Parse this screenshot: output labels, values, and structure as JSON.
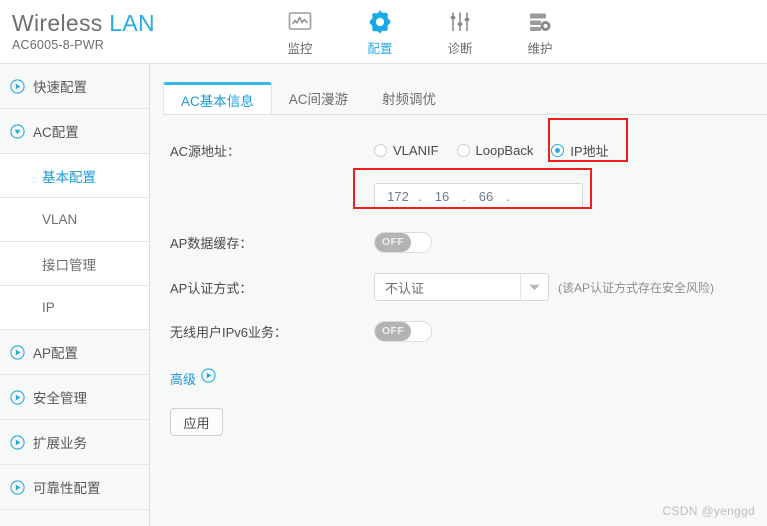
{
  "header": {
    "brand_main": "Wireless",
    "brand_accent": "LAN",
    "model": "AC6005-8-PWR",
    "nav": [
      {
        "label": "监控",
        "icon": "monitor-chart-icon",
        "active": false
      },
      {
        "label": "配置",
        "icon": "gear-icon",
        "active": true
      },
      {
        "label": "诊断",
        "icon": "sliders-icon",
        "active": false
      },
      {
        "label": "维护",
        "icon": "server-gear-icon",
        "active": false
      }
    ]
  },
  "sidebar": {
    "items": [
      {
        "label": "快速配置",
        "icon": "circle-play-icon",
        "type": "group",
        "expanded": false
      },
      {
        "label": "AC配置",
        "icon": "circle-chevron-down-icon",
        "type": "group",
        "expanded": true
      },
      {
        "label": "基本配置",
        "type": "sub",
        "active": true
      },
      {
        "label": "VLAN",
        "type": "sub",
        "active": false
      },
      {
        "label": "接口管理",
        "type": "sub",
        "active": false
      },
      {
        "label": "IP",
        "type": "sub",
        "active": false
      },
      {
        "label": "AP配置",
        "icon": "circle-play-icon",
        "type": "group",
        "expanded": false
      },
      {
        "label": "安全管理",
        "icon": "circle-play-icon",
        "type": "group",
        "expanded": false
      },
      {
        "label": "扩展业务",
        "icon": "circle-play-icon",
        "type": "group",
        "expanded": false
      },
      {
        "label": "可靠性配置",
        "icon": "circle-play-icon",
        "type": "group",
        "expanded": false
      }
    ]
  },
  "main": {
    "tabs": [
      {
        "label": "AC基本信息",
        "active": true
      },
      {
        "label": "AC间漫游",
        "active": false
      },
      {
        "label": "射频调优",
        "active": false
      }
    ],
    "rows": {
      "source_address": {
        "label": "AC源地址：",
        "options": [
          {
            "label": "VLANIF",
            "checked": false
          },
          {
            "label": "LoopBack",
            "checked": false
          },
          {
            "label": "IP地址",
            "checked": true
          }
        ],
        "ip": {
          "o1": "172",
          "o2": "16",
          "o3": "66",
          "o4": "",
          "dot": "."
        }
      },
      "ap_data_cache": {
        "label": "AP数据缓存：",
        "toggle_state": "OFF"
      },
      "ap_auth_mode": {
        "label": "AP认证方式：",
        "value": "不认证",
        "hint": "(该AP认证方式存在安全风险)"
      },
      "ipv6_service": {
        "label": "无线用户IPv6业务：",
        "toggle_state": "OFF"
      }
    },
    "advanced_label": "高级",
    "apply_label": "应用"
  },
  "watermark": "CSDN @yenggd",
  "colors": {
    "accent": "#29abe2",
    "annotation": "#f21d1d",
    "text": "#4a4a4a",
    "muted": "#8d8d8d"
  }
}
